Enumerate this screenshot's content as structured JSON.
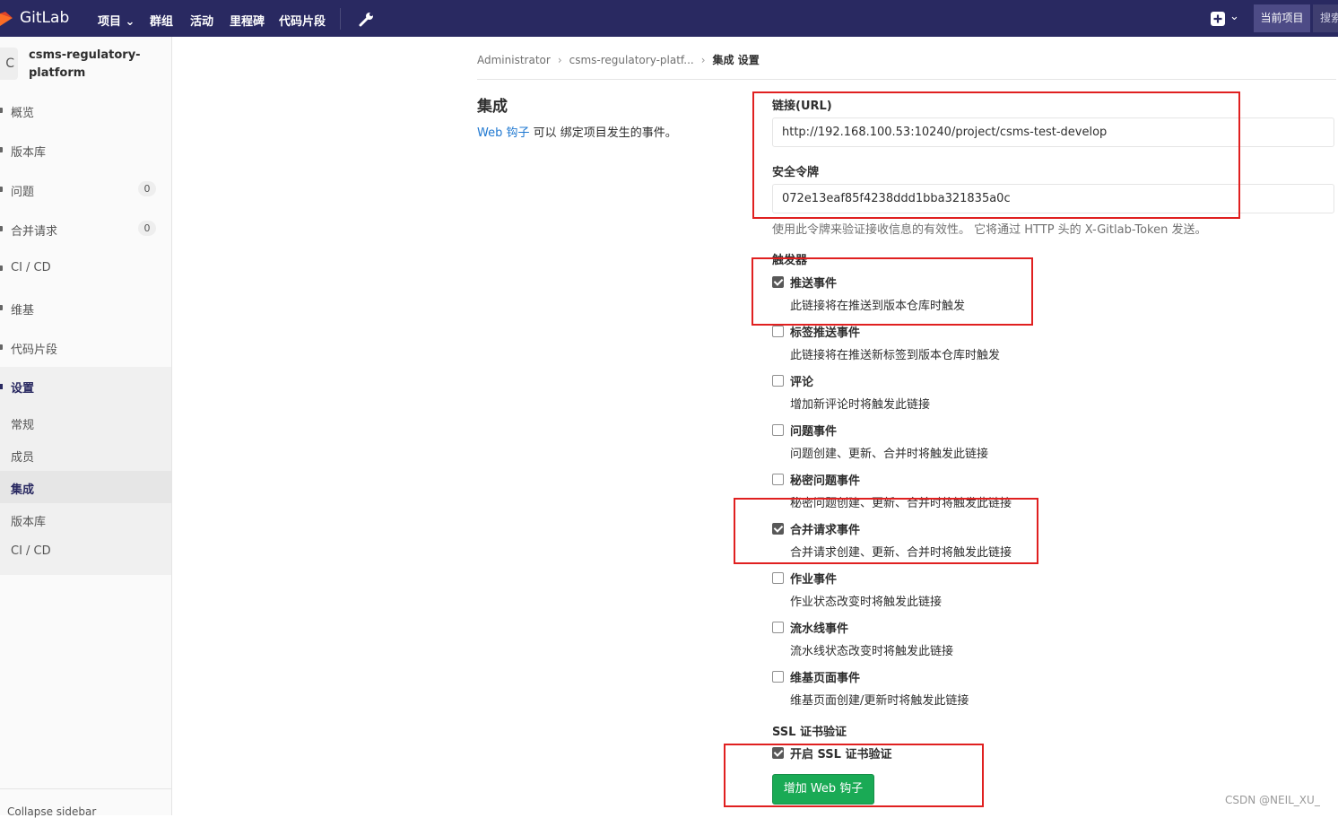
{
  "navbar": {
    "brand": "GitLab",
    "items": [
      "项目",
      "群组",
      "活动",
      "里程碑",
      "代码片段"
    ],
    "current_project_btn": "当前项目",
    "search_btn": "搜索"
  },
  "sidebar": {
    "avatar_letter": "C",
    "project_name": "csms-regulatory-platform",
    "items": [
      {
        "label": "概览"
      },
      {
        "label": "版本库"
      },
      {
        "label": "问题",
        "count": "0"
      },
      {
        "label": "合并请求",
        "count": "0"
      },
      {
        "label": "CI / CD"
      },
      {
        "label": "维基"
      },
      {
        "label": "代码片段"
      }
    ],
    "settings": {
      "label": "设置",
      "sub": [
        "常规",
        "成员",
        "集成",
        "版本库",
        "CI / CD"
      ]
    },
    "collapse": "Collapse sidebar"
  },
  "breadcrumb": {
    "items": [
      "Administrator",
      "csms-regulatory-platf...",
      "集成 设置"
    ]
  },
  "section": {
    "title": "集成",
    "desc_link": "Web 钩子",
    "desc_rest": " 可以 绑定项目发生的事件。"
  },
  "form": {
    "url_label": "链接(URL)",
    "url_value": "http://192.168.100.53:10240/project/csms-test-develop",
    "token_label": "安全令牌",
    "token_value": "072e13eaf85f4238ddd1bba321835a0c",
    "token_help": "使用此令牌来验证接收信息的有效性。 它将通过 HTTP 头的 X-Gitlab-Token 发送。",
    "triggers_label": "触发器",
    "triggers": [
      {
        "title": "推送事件",
        "desc": "此链接将在推送到版本仓库时触发",
        "checked": true
      },
      {
        "title": "标签推送事件",
        "desc": "此链接将在推送新标签到版本仓库时触发",
        "checked": false
      },
      {
        "title": "评论",
        "desc": "增加新评论时将触发此链接",
        "checked": false
      },
      {
        "title": "问题事件",
        "desc": "问题创建、更新、合并时将触发此链接",
        "checked": false
      },
      {
        "title": "秘密问题事件",
        "desc": "秘密问题创建、更新、合并时将触发此链接",
        "checked": false
      },
      {
        "title": "合并请求事件",
        "desc": "合并请求创建、更新、合并时将触发此链接",
        "checked": true
      },
      {
        "title": "作业事件",
        "desc": "作业状态改变时将触发此链接",
        "checked": false
      },
      {
        "title": "流水线事件",
        "desc": "流水线状态改变时将触发此链接",
        "checked": false
      },
      {
        "title": "维基页面事件",
        "desc": "维基页面创建/更新时将触发此链接",
        "checked": false
      }
    ],
    "ssl_label": "SSL 证书验证",
    "ssl_option": "开启 SSL 证书验证",
    "ssl_checked": true,
    "submit": "增加 Web 钩子"
  },
  "watermark": "CSDN @NEIL_XU_",
  "colors": {
    "navbar": "#292961",
    "primary_button": "#1aaa55",
    "link": "#1f78d1",
    "annotation": "#e02020"
  }
}
